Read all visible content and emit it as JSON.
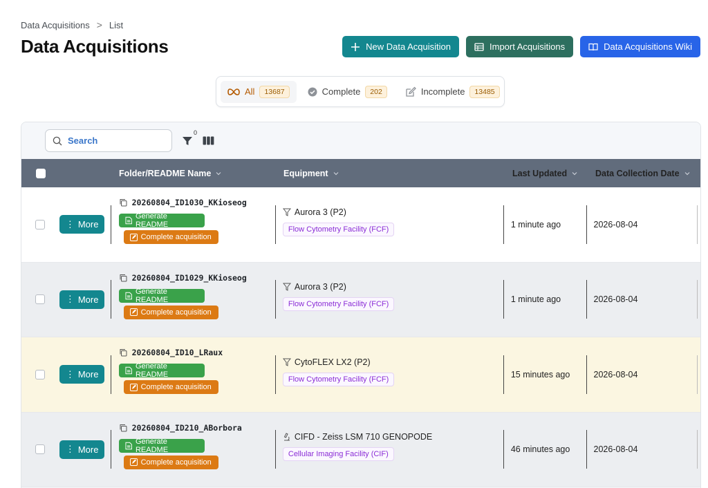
{
  "breadcrumb": {
    "parent": "Data Acquisitions",
    "separator": ">",
    "current": "List"
  },
  "title": "Data Acquisitions",
  "actions": {
    "new_label": "New Data Acquisition",
    "import_label": "Import Acquisitions",
    "wiki_label": "Data Acquisitions Wiki"
  },
  "tabs": {
    "all": {
      "label": "All",
      "count": "13687"
    },
    "complete": {
      "label": "Complete",
      "count": "202"
    },
    "incomplete": {
      "label": "Incomplete",
      "count": "13485"
    }
  },
  "toolbar": {
    "search_placeholder": "Search",
    "filter_count": "0"
  },
  "columns": {
    "name": "Folder/README Name",
    "equipment": "Equipment",
    "updated": "Last Updated",
    "date": "Data Collection Date"
  },
  "row_buttons": {
    "more": "More",
    "readme": "Generate README",
    "complete": "Complete acquisition"
  },
  "rows": [
    {
      "name": "20260804_ID1030_KKioseog",
      "equipment": "Aurora 3 (P2)",
      "facility": "Flow Cytometry Facility (FCF)",
      "updated": "1 minute ago",
      "date": "2026-08-04"
    },
    {
      "name": "20260804_ID1029_KKioseog",
      "equipment": "Aurora 3 (P2)",
      "facility": "Flow Cytometry Facility (FCF)",
      "updated": "1 minute ago",
      "date": "2026-08-04"
    },
    {
      "name": "20260804_ID10_LRaux",
      "equipment": "CytoFLEX LX2 (P2)",
      "facility": "Flow Cytometry Facility (FCF)",
      "updated": "15 minutes ago",
      "date": "2026-08-04"
    },
    {
      "name": "20260804_ID210_ABorbora",
      "equipment": "CIFD - Zeiss LSM 710 GENOPODE",
      "facility": "Cellular Imaging Facility (CIF)",
      "updated": "46 minutes ago",
      "date": "2026-08-04"
    }
  ],
  "colors": {
    "teal": "#13878f",
    "green_button": "#2d6f5f",
    "blue": "#2864e8",
    "header_bg": "#616c7c",
    "highlight_row": "#fbf6e1"
  }
}
